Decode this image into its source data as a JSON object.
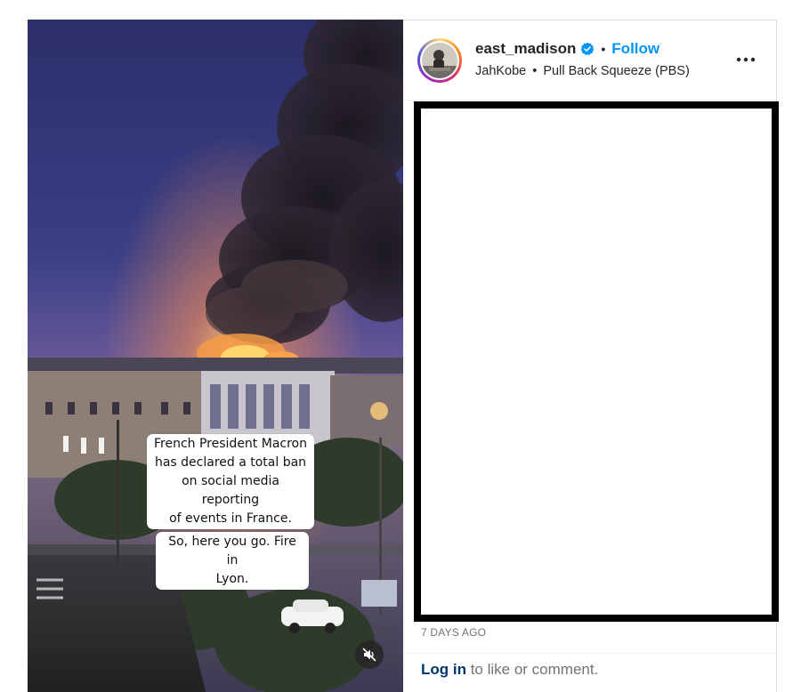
{
  "post": {
    "media": {
      "captions": [
        "French President Macron\nhas declared a total ban\non social media reporting\nof events in France.",
        "So, here you go. Fire in\nLyon."
      ],
      "mute_icon": "speaker-muted-icon"
    },
    "header": {
      "username": "east_madison",
      "verified_icon": "verified-badge-icon",
      "separator": "•",
      "follow_label": "Follow",
      "audio": {
        "artist": "JahKobe",
        "separator": "•",
        "track": "Pull Back Squeeze (PBS)"
      },
      "more_icon": "more-options-icon"
    },
    "timestamp": "7 DAYS AGO",
    "footer": {
      "login_link": "Log in",
      "login_suffix": " to like or comment."
    }
  },
  "colors": {
    "link_blue": "#0095f6",
    "login_blue": "#00376b",
    "muted_text": "#737373",
    "redaction_border": "#000000"
  }
}
